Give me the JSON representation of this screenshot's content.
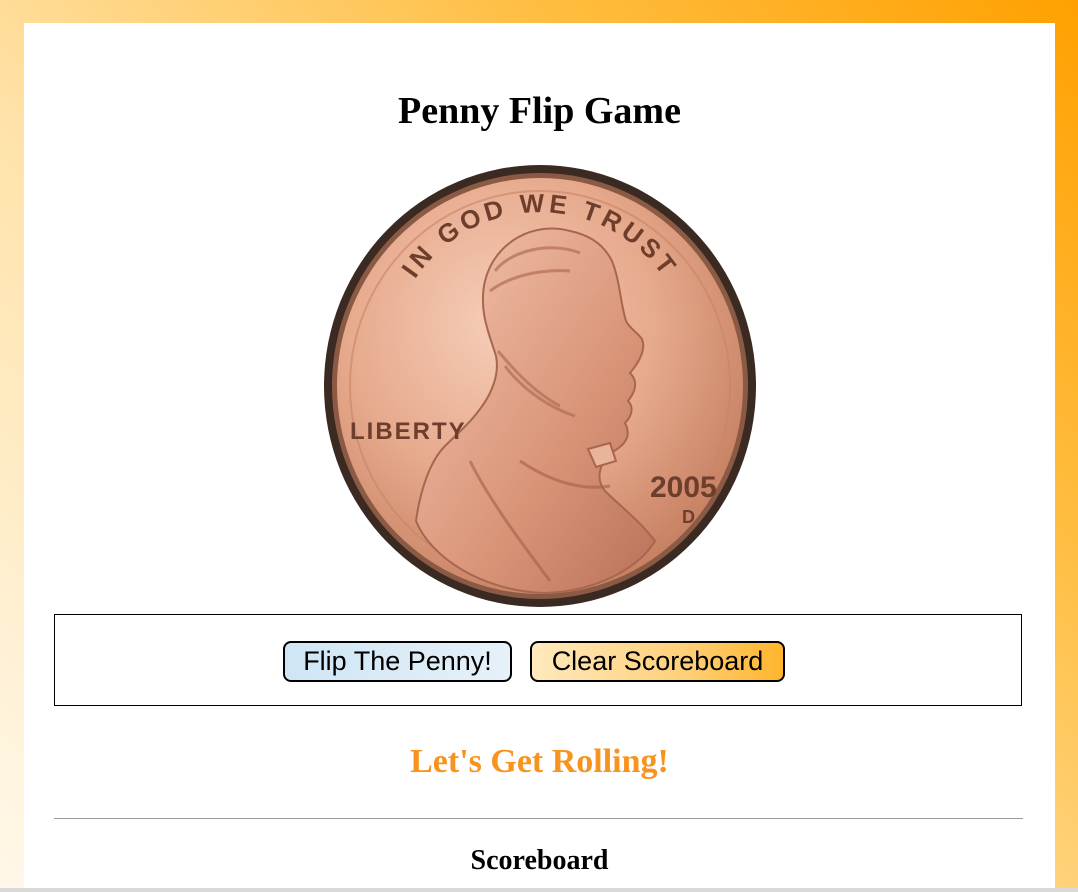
{
  "page": {
    "title": "Penny Flip Game",
    "background_colors": [
      "#fff8ea",
      "#ffbe42",
      "#ffa000"
    ]
  },
  "coin": {
    "icon": "penny-heads-icon",
    "motto": "IN GOD WE TRUST",
    "left_text": "LIBERTY",
    "year": "2005",
    "mint_mark": "D",
    "colors": {
      "face": "#e3a689",
      "rim": "#3a2a22",
      "relief": "#c98468"
    }
  },
  "controls": {
    "flip_label": "Flip The Penny!",
    "clear_label": "Clear Scoreboard"
  },
  "status": {
    "message": "Let's Get Rolling!",
    "color": "#f7931e"
  },
  "scoreboard": {
    "heading": "Scoreboard"
  }
}
